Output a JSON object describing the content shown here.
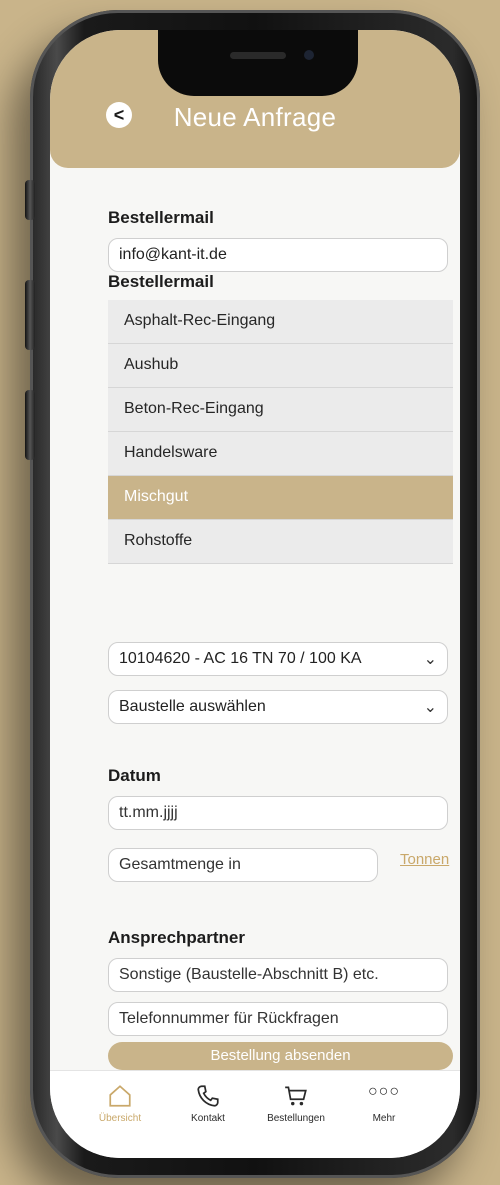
{
  "header": {
    "title": "Neue Anfrage",
    "back_glyph": "<"
  },
  "form": {
    "email_label": "Bestellermail",
    "email_value": "info@kant-it.de",
    "category_label": "Bestellermail",
    "categories": [
      {
        "label": "Asphalt-Rec-Eingang",
        "selected": false
      },
      {
        "label": "Aushub",
        "selected": false
      },
      {
        "label": "Beton-Rec-Eingang",
        "selected": false
      },
      {
        "label": "Handelsware",
        "selected": false
      },
      {
        "label": "Mischgut",
        "selected": true
      },
      {
        "label": "Rohstoffe",
        "selected": false
      }
    ],
    "product_select": "10104620 - AC 16 TN 70 / 100 KA",
    "site_select": "Baustelle auswählen",
    "date_label": "Datum",
    "date_placeholder": "tt.mm.jjjj",
    "quantity_placeholder": "Gesamtmenge in",
    "quantity_unit": "Tonnen",
    "contact_label": "Ansprechpartner",
    "contact_placeholder": "Sonstige (Baustelle-Abschnitt B) etc.",
    "phone_placeholder": "Telefonnummer für Rückfragen",
    "submit_label": "Bestellung absenden"
  },
  "tabbar": {
    "items": [
      {
        "label": "Übersicht",
        "icon": "home-icon",
        "active": true
      },
      {
        "label": "Kontakt",
        "icon": "phone-icon",
        "active": false
      },
      {
        "label": "Bestellungen",
        "icon": "cart-icon",
        "active": false
      },
      {
        "label": "Mehr",
        "icon": "more-icon",
        "active": false
      }
    ]
  },
  "colors": {
    "accent": "#c9b48a",
    "link": "#c9a86a",
    "background": "#f7f7f5"
  }
}
